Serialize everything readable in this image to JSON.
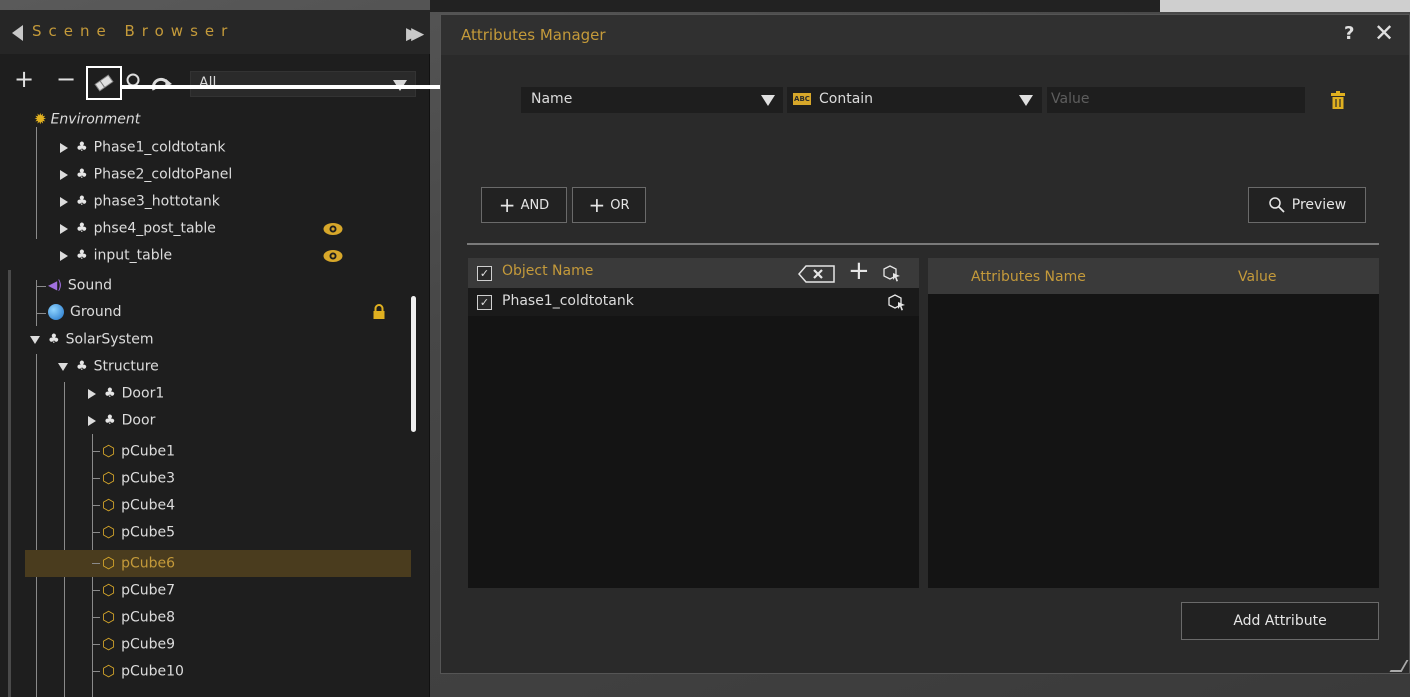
{
  "scene_browser": {
    "title": "Scene Browser",
    "filter": {
      "value": "All"
    },
    "toolbar": {
      "add_label": "+",
      "remove_label": "−"
    },
    "tree": {
      "environment": "Environment",
      "phase1": "Phase1_coldtotank",
      "phase2": "Phase2_coldtoPanel",
      "phase3": "phase3_hottotank",
      "phase4": "phse4_post_table",
      "input_table": "input_table",
      "sound": "Sound",
      "ground": "Ground",
      "solar_system": "SolarSystem",
      "structure": "Structure",
      "door1": "Door1",
      "door": "Door",
      "pcube1": "pCube1",
      "pcube3": "pCube3",
      "pcube4": "pCube4",
      "pcube5": "pCube5",
      "pcube6": "pCube6",
      "pcube7": "pCube7",
      "pcube8": "pCube8",
      "pcube9": "pCube9",
      "pcube10": "pCube10"
    }
  },
  "attributes_manager": {
    "title": "Attributes Manager",
    "help": "?",
    "close": "✕",
    "filter": {
      "field": "Name",
      "condition": "Contain",
      "value_placeholder": "Value"
    },
    "and_label": "AND",
    "or_label": "OR",
    "preview_label": "Preview",
    "object_header": "Object Name",
    "objects": [
      "Phase1_coldtotank"
    ],
    "attr_name_header": "Attributes Name",
    "attr_value_header": "Value",
    "add_attribute_label": "Add Attribute"
  },
  "colors": {
    "accent": "#c49a3a",
    "selection": "#4a3c1e",
    "panel_bg": "#1e1e1e",
    "dialog_bg": "#2a2a2a"
  }
}
